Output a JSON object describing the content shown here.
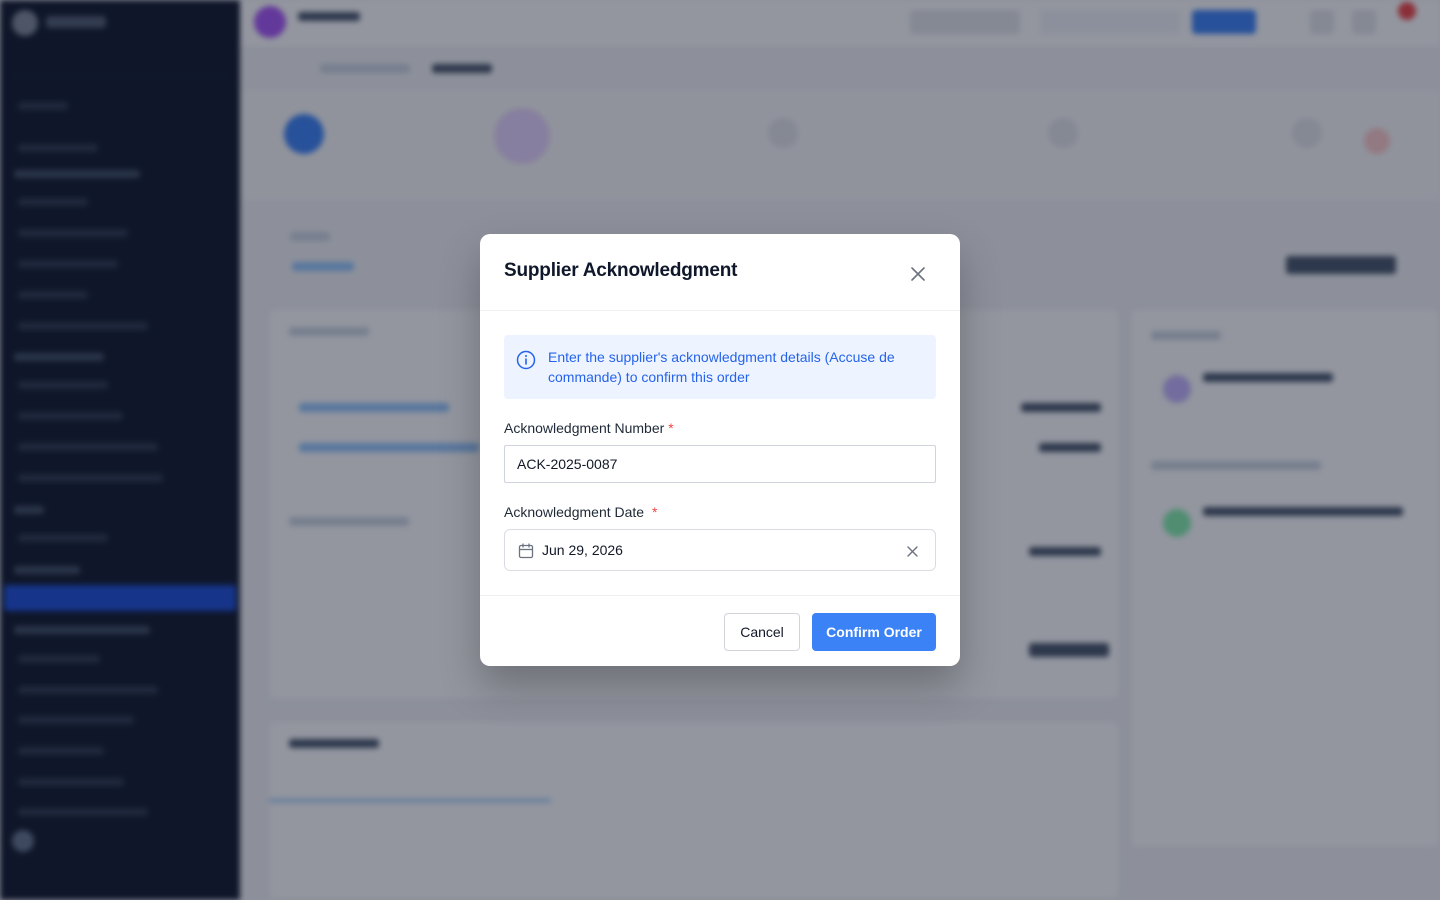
{
  "modal": {
    "title": "Supplier Acknowledgment",
    "info_text": "Enter the supplier's acknowledgment details (Accuse de commande) to confirm this order",
    "ack_number_label": "Acknowledgment Number",
    "ack_number_value": "ACK-2025-0087",
    "ack_date_label": "Acknowledgment Date",
    "ack_date_value": "Jun 29, 2026",
    "required_mark": "*",
    "cancel_label": "Cancel",
    "confirm_label": "Confirm Order"
  },
  "colors": {
    "primary": "#3b82f6",
    "info_bg": "#eef4ff",
    "info_text": "#2563eb",
    "required": "#ef4444",
    "sidebar_bg": "#0f172a",
    "sidebar_active": "#1d4ed8"
  },
  "icons": [
    "info-icon",
    "close-icon",
    "calendar-icon",
    "clear-icon"
  ]
}
